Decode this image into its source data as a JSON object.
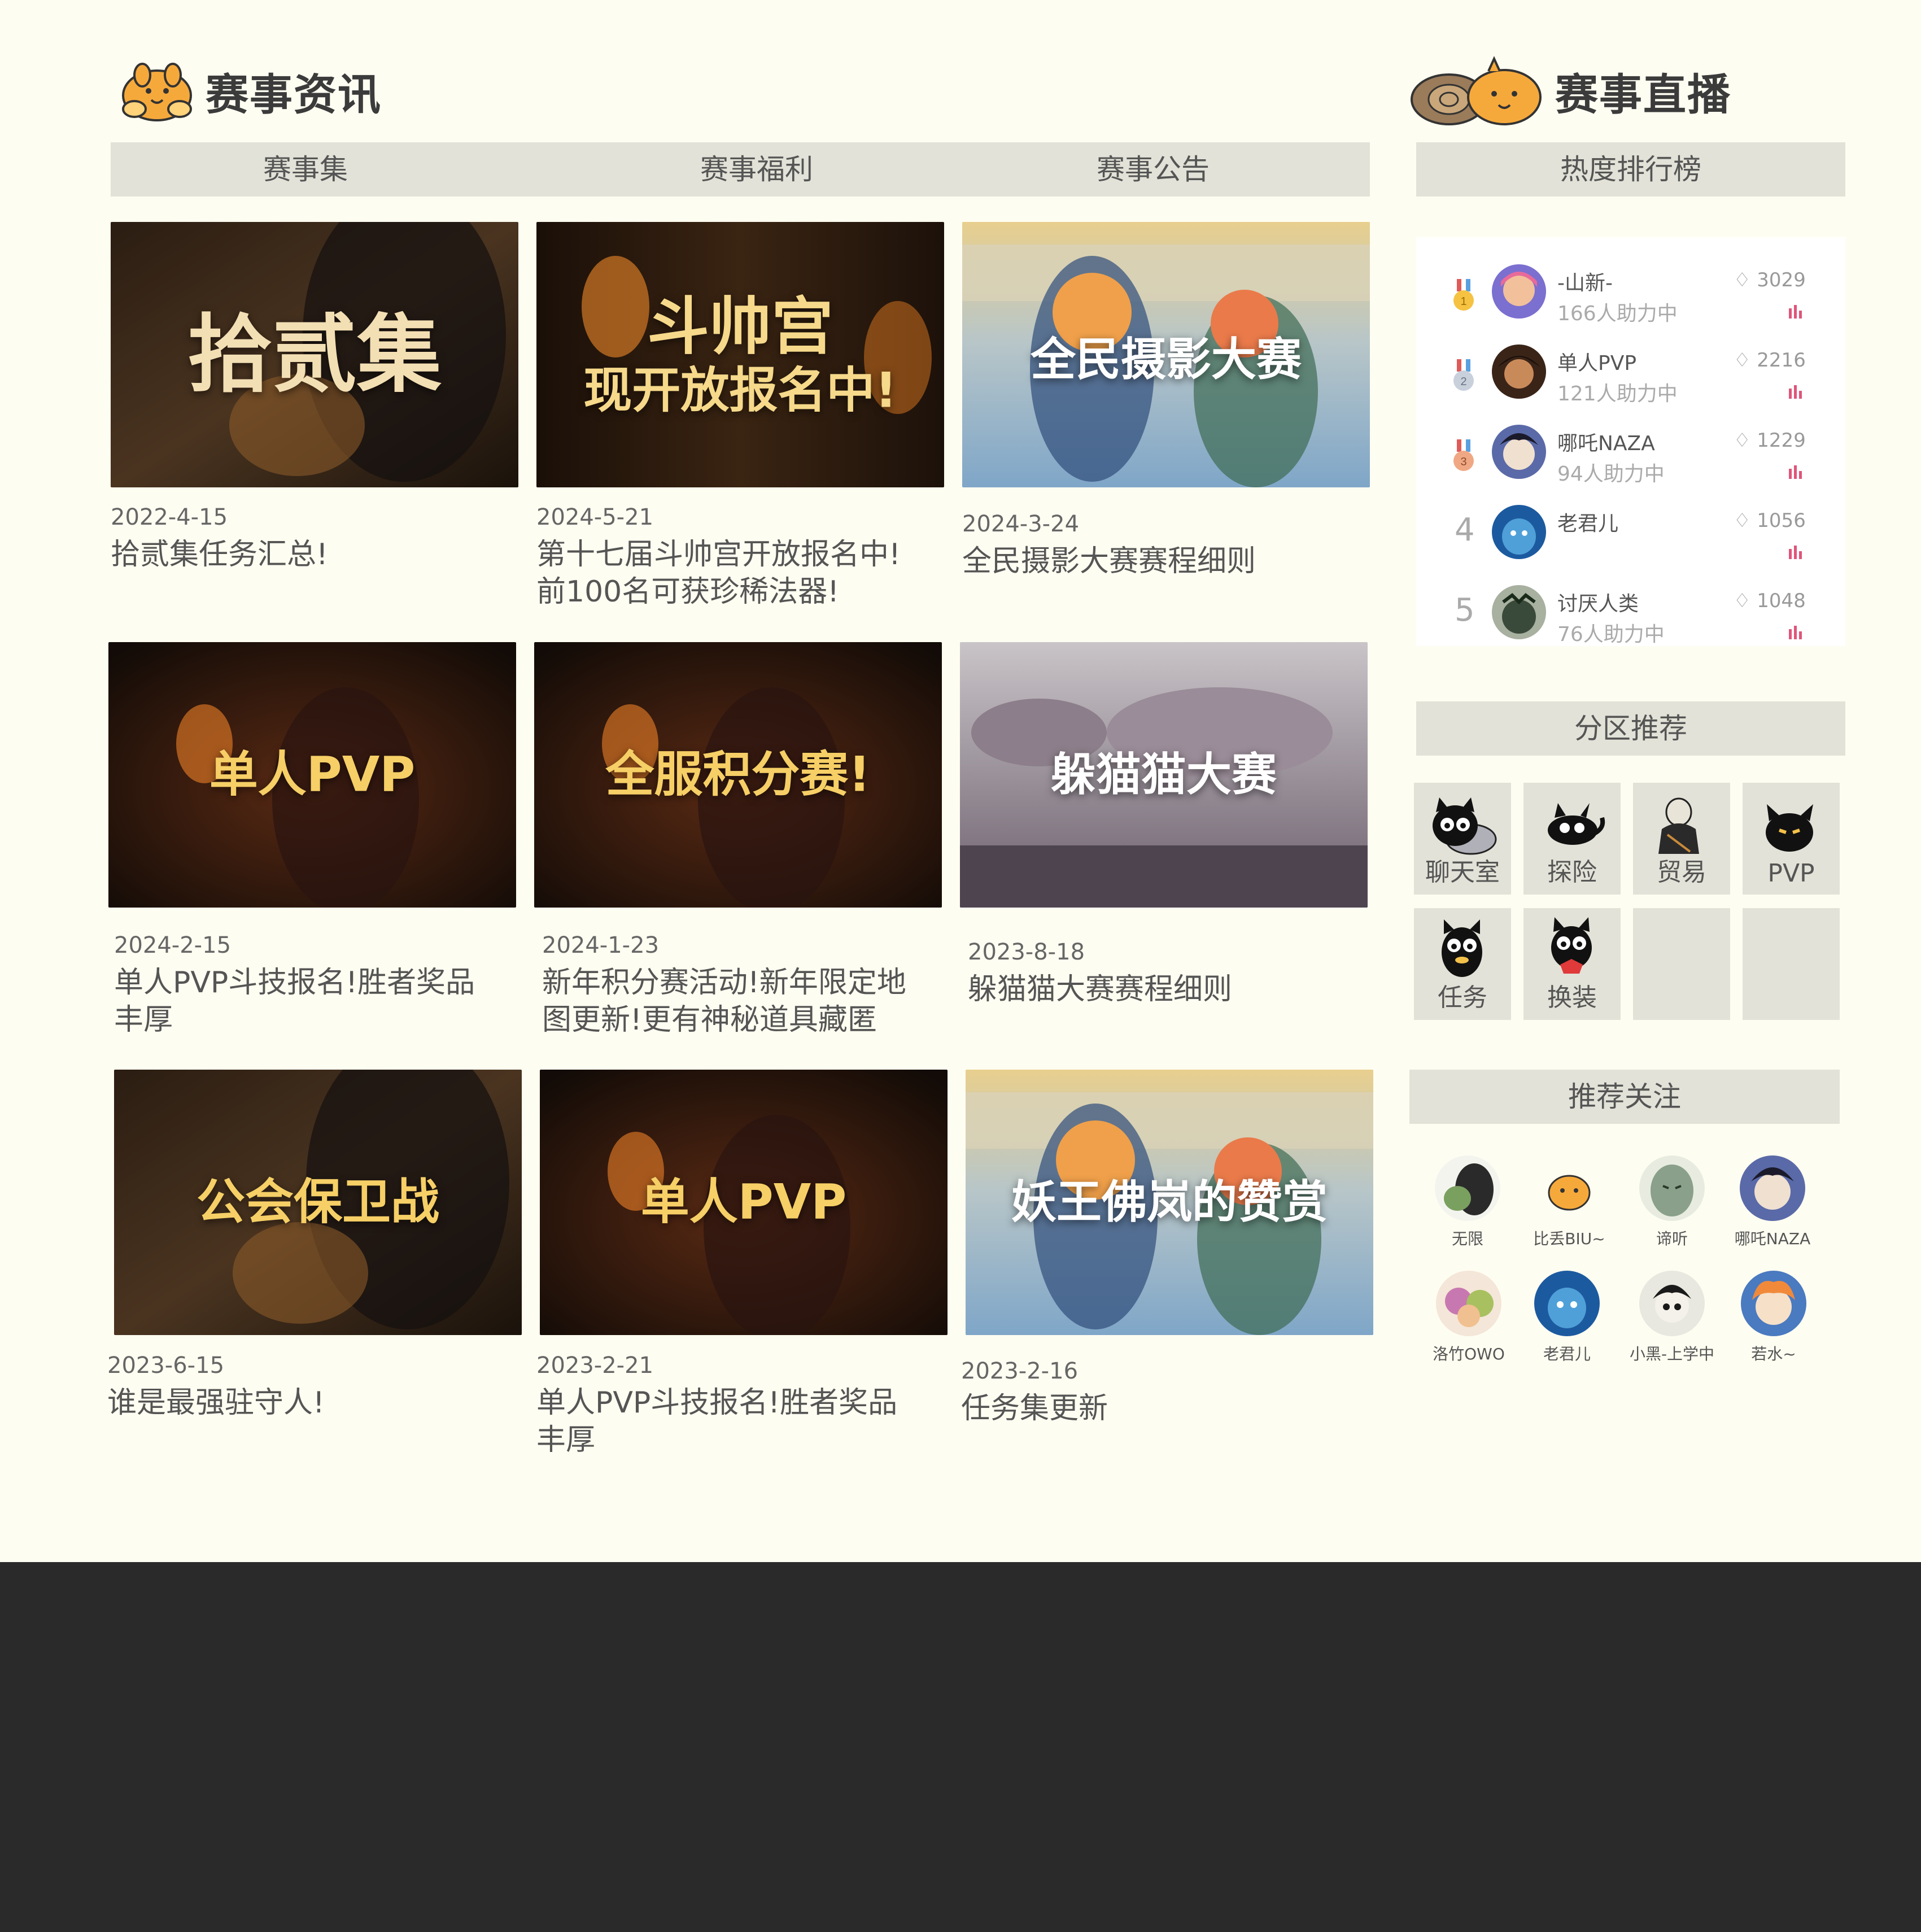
{
  "news": {
    "title": "赛事资讯",
    "tabs": [
      "赛事集",
      "赛事福利",
      "赛事公告"
    ],
    "cards": [
      {
        "caption": "拾贰集",
        "caption2": "",
        "date": "2022-4-15",
        "title": "拾贰集任务汇总!",
        "title2": ""
      },
      {
        "caption": "斗帅宫",
        "caption2": "现开放报名中!",
        "date": "2024-5-21",
        "title": "第十七届斗帅宫开放报名中!",
        "title2": "前100名可获珍稀法器!"
      },
      {
        "caption": "全民摄影大赛",
        "caption2": "",
        "date": "2024-3-24",
        "title": "全民摄影大赛赛程细则",
        "title2": ""
      },
      {
        "caption": "单人PVP",
        "caption2": "",
        "date": "2024-2-15",
        "title": "单人PVP斗技报名!胜者奖品",
        "title2": "丰厚"
      },
      {
        "caption": "全服积分赛!",
        "caption2": "",
        "date": "2024-1-23",
        "title": "新年积分赛活动!新年限定地",
        "title2": "图更新!更有神秘道具藏匿"
      },
      {
        "caption": "躲猫猫大赛",
        "caption2": "",
        "date": "2023-8-18",
        "title": "躲猫猫大赛赛程细则",
        "title2": ""
      },
      {
        "caption": "公会保卫战",
        "caption2": "",
        "date": "2023-6-15",
        "title": "谁是最强驻守人!",
        "title2": ""
      },
      {
        "caption": "单人PVP",
        "caption2": "",
        "date": "2023-2-21",
        "title": "单人PVP斗技报名!胜者奖品",
        "title2": "丰厚"
      },
      {
        "caption": "妖王佛岚的赞赏",
        "caption2": "",
        "date": "2023-2-16",
        "title": "任务集更新",
        "title2": ""
      }
    ]
  },
  "live": {
    "title": "赛事直播",
    "ranking_title": "热度排行榜",
    "ranking": [
      {
        "rank": "1",
        "name": "-山新-",
        "sub": "166人助力中",
        "score": "3029"
      },
      {
        "rank": "2",
        "name": "单人PVP",
        "sub": "121人助力中",
        "score": "2216"
      },
      {
        "rank": "3",
        "name": "哪吒NAZA",
        "sub": "94人助力中",
        "score": "1229"
      },
      {
        "rank": "4",
        "name": "老君儿",
        "sub": "",
        "score": "1056"
      },
      {
        "rank": "5",
        "name": "讨厌人类",
        "sub": "76人助力中",
        "score": "1048"
      }
    ],
    "zones_title": "分区推荐",
    "zones": [
      "聊天室",
      "探险",
      "贸易",
      "PVP",
      "任务",
      "换装",
      "",
      ""
    ],
    "follow_title": "推荐关注",
    "follows": [
      "无限",
      "比丢BIU~",
      "谛听",
      "哪吒NAZA",
      "洛竹OWO",
      "老君儿",
      "小黑-上学中",
      "若水~"
    ]
  },
  "colors": {
    "page_bg": "#fefdf1",
    "bar_bg": "#e2e2d8",
    "caption_gold": "#f6cf66",
    "footer": "#2a2a2a",
    "bar_pink": "#e0557a"
  }
}
